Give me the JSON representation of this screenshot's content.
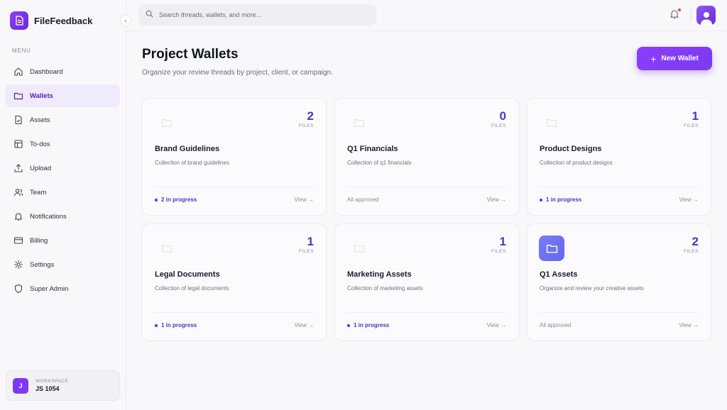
{
  "app": {
    "name": "FileFeedback"
  },
  "sidebar": {
    "collapse_glyph": "‹",
    "menu_label": "MENU",
    "items": [
      {
        "label": "Dashboard",
        "icon": "home-icon"
      },
      {
        "label": "Wallets",
        "icon": "folder-icon",
        "active": true
      },
      {
        "label": "Assets",
        "icon": "file-check-icon"
      },
      {
        "label": "To-dos",
        "icon": "layout-icon"
      },
      {
        "label": "Upload",
        "icon": "upload-icon"
      },
      {
        "label": "Team",
        "icon": "users-icon"
      },
      {
        "label": "Notifications",
        "icon": "bell-icon"
      },
      {
        "label": "Billing",
        "icon": "credit-card-icon"
      },
      {
        "label": "Settings",
        "icon": "gear-icon"
      },
      {
        "label": "Super Admin",
        "icon": "shield-icon"
      }
    ],
    "workspace": {
      "initial": "J",
      "label": "WORKSPACE",
      "name": "JS 1054"
    }
  },
  "topbar": {
    "search_placeholder": "Search threads, wallets, and more...",
    "has_notification": true
  },
  "header": {
    "title": "Project Wallets",
    "subtitle": "Organize your review threads by project, client, or campaign.",
    "new_wallet_label": "New Wallet",
    "new_wallet_icon": "+"
  },
  "files_label": "FILES",
  "view_label": "View →",
  "wallets": [
    {
      "name": "Brand Guidelines",
      "description": "Collection of brand guidelines",
      "count": "2",
      "status": "2 in progress",
      "status_type": "progress",
      "folder_style": "faint"
    },
    {
      "name": "Q1 Financials",
      "description": "Collection of q1 financials",
      "count": "0",
      "status": "All approved",
      "status_type": "approved",
      "folder_style": "faint"
    },
    {
      "name": "Product Designs",
      "description": "Collection of product designs",
      "count": "1",
      "status": "1 in progress",
      "status_type": "progress",
      "folder_style": "faint"
    },
    {
      "name": "Legal Documents",
      "description": "Collection of legal documents",
      "count": "1",
      "status": "1 in progress",
      "status_type": "progress",
      "folder_style": "faint"
    },
    {
      "name": "Marketing Assets",
      "description": "Collection of marketing assets",
      "count": "1",
      "status": "1 in progress",
      "status_type": "progress",
      "folder_style": "faint"
    },
    {
      "name": "Q1 Assets",
      "description": "Organize and review your creative assets",
      "count": "2",
      "status": "All approved",
      "status_type": "approved",
      "folder_style": "solid"
    }
  ],
  "colors": {
    "accent": "#7c3aed",
    "accent_dark": "#4338ca",
    "active_bg": "#efeafc"
  }
}
